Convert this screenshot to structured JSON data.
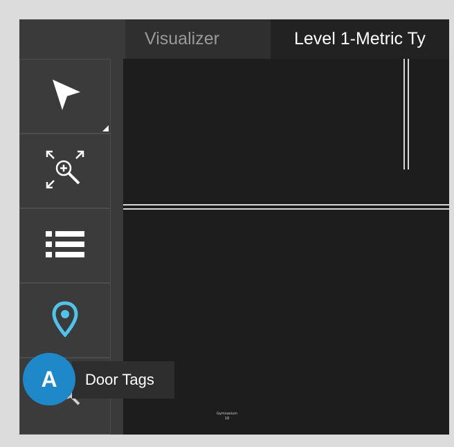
{
  "tabs": {
    "visualizer": "Visualizer",
    "level": "Level 1-Metric Ty"
  },
  "toolbar": {
    "select_icon": "cursor-arrow-icon",
    "zoom_extents_icon": "zoom-extents-icon",
    "list_icon": "list-icon",
    "location_icon": "map-pin-icon",
    "search_icon": "magnifier-icon"
  },
  "canvas": {
    "room_tag_name": "Gymnasium",
    "room_tag_number": "18"
  },
  "tooltip": {
    "text": "Door Tags"
  },
  "callout": {
    "letter": "A"
  },
  "colors": {
    "accent": "#4fc3ea",
    "badge": "#1e88c9",
    "panel": "#3a3a3a",
    "canvas": "#1d1d1d"
  }
}
